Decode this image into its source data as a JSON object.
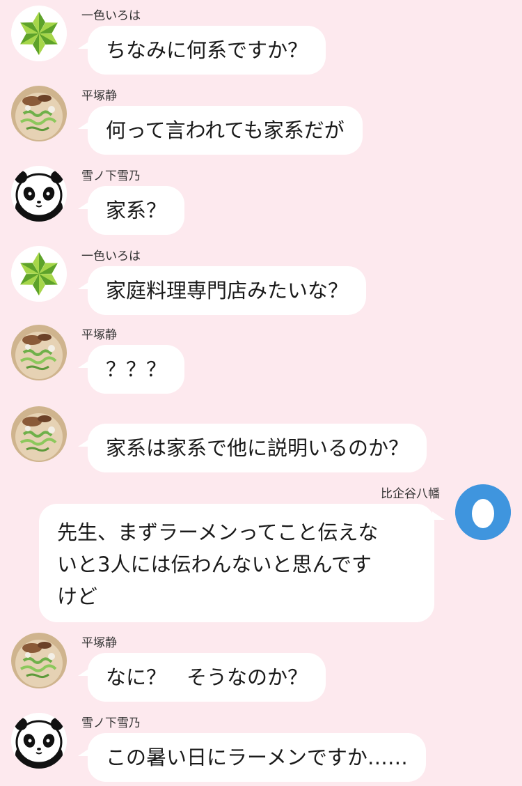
{
  "colors": {
    "background": "#fde9ee",
    "bubble": "#ffffff",
    "iroha_star_light": "#a6d64a",
    "iroha_star_dark": "#5da22a",
    "hachiman_avatar": "#3f95de"
  },
  "messages": [
    {
      "sender": "一色いろは",
      "avatar": "green-star-icon",
      "text": "ちなみに何系ですか？"
    },
    {
      "sender": "平塚静",
      "avatar": "ramen-photo-icon",
      "text": "何って言われても家系だが"
    },
    {
      "sender": "雪ノ下雪乃",
      "avatar": "panda-icon",
      "text": "家系？"
    },
    {
      "sender": "一色いろは",
      "avatar": "green-star-icon",
      "text": "家庭料理専門店みたいな？"
    },
    {
      "sender": "平塚静",
      "avatar": "ramen-photo-icon",
      "text": "？？？"
    },
    {
      "sender": "",
      "avatar": "ramen-photo-icon",
      "text": "家系は家系で他に説明いるのか？"
    },
    {
      "sender": "比企谷八幡",
      "avatar": "egg-icon",
      "lines": [
        "先生、まずラーメンってこと伝えな",
        "いと3人には伝わんないと思んです",
        "けど"
      ]
    },
    {
      "sender": "平塚静",
      "avatar": "ramen-photo-icon",
      "text": "なに？　そうなのか？"
    },
    {
      "sender": "雪ノ下雪乃",
      "avatar": "panda-icon",
      "text": "この暑い日にラーメンですか……"
    }
  ]
}
